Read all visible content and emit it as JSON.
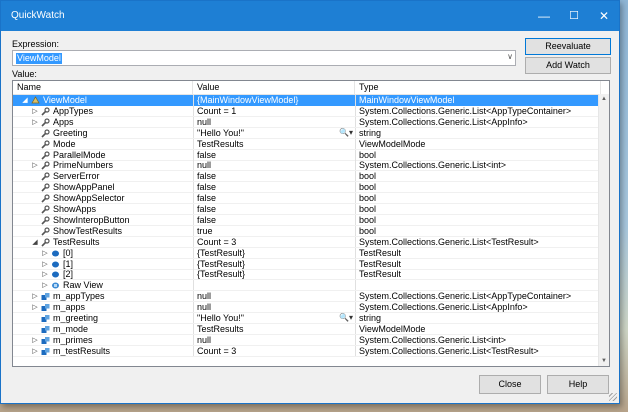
{
  "window": {
    "title": "QuickWatch",
    "minimize_icon": "—",
    "maximize_icon": "☐",
    "close_icon": "✕"
  },
  "expression": {
    "label": "Expression:",
    "value": "ViewModel",
    "dropdown_icon": "∨"
  },
  "value_label": "Value:",
  "buttons": {
    "reevaluate": "Reevaluate",
    "add_watch": "Add Watch",
    "close": "Close",
    "help": "Help"
  },
  "columns": {
    "name": "Name",
    "value": "Value",
    "type": "Type"
  },
  "rows": [
    {
      "indent": 0,
      "expander": "◢",
      "icon": "class",
      "name": "ViewModel",
      "value": "{MainWindowViewModel}",
      "type": "MainWindowViewModel",
      "selected": true
    },
    {
      "indent": 1,
      "expander": "▷",
      "icon": "wrench",
      "name": "AppTypes",
      "value": "Count = 1",
      "type": "System.Collections.Generic.List<AppTypeContainer>"
    },
    {
      "indent": 1,
      "expander": "▷",
      "icon": "wrench",
      "name": "Apps",
      "value": "null",
      "type": "System.Collections.Generic.List<AppInfo>"
    },
    {
      "indent": 1,
      "expander": "",
      "icon": "wrench",
      "name": "Greeting",
      "value": "\"Hello You!\"",
      "type": "string",
      "magnifier": true
    },
    {
      "indent": 1,
      "expander": "",
      "icon": "wrench",
      "name": "Mode",
      "value": "TestResults",
      "type": "ViewModelMode"
    },
    {
      "indent": 1,
      "expander": "",
      "icon": "wrench",
      "name": "ParallelMode",
      "value": "false",
      "type": "bool"
    },
    {
      "indent": 1,
      "expander": "▷",
      "icon": "wrench",
      "name": "PrimeNumbers",
      "value": "null",
      "type": "System.Collections.Generic.List<int>"
    },
    {
      "indent": 1,
      "expander": "",
      "icon": "wrench",
      "name": "ServerError",
      "value": "false",
      "type": "bool"
    },
    {
      "indent": 1,
      "expander": "",
      "icon": "wrench",
      "name": "ShowAppPanel",
      "value": "false",
      "type": "bool"
    },
    {
      "indent": 1,
      "expander": "",
      "icon": "wrench",
      "name": "ShowAppSelector",
      "value": "false",
      "type": "bool"
    },
    {
      "indent": 1,
      "expander": "",
      "icon": "wrench",
      "name": "ShowApps",
      "value": "false",
      "type": "bool"
    },
    {
      "indent": 1,
      "expander": "",
      "icon": "wrench",
      "name": "ShowInteropButton",
      "value": "false",
      "type": "bool"
    },
    {
      "indent": 1,
      "expander": "",
      "icon": "wrench",
      "name": "ShowTestResults",
      "value": "true",
      "type": "bool"
    },
    {
      "indent": 1,
      "expander": "◢",
      "icon": "wrench",
      "name": "TestResults",
      "value": "Count = 3",
      "type": "System.Collections.Generic.List<TestResult>"
    },
    {
      "indent": 2,
      "expander": "▷",
      "icon": "item",
      "name": "[0]",
      "value": "{TestResult}",
      "type": "TestResult"
    },
    {
      "indent": 2,
      "expander": "▷",
      "icon": "item",
      "name": "[1]",
      "value": "{TestResult}",
      "type": "TestResult"
    },
    {
      "indent": 2,
      "expander": "▷",
      "icon": "item",
      "name": "[2]",
      "value": "{TestResult}",
      "type": "TestResult"
    },
    {
      "indent": 2,
      "expander": "▷",
      "icon": "raw",
      "name": "Raw View",
      "value": "",
      "type": ""
    },
    {
      "indent": 1,
      "expander": "▷",
      "icon": "field",
      "name": "m_appTypes",
      "value": "null",
      "type": "System.Collections.Generic.List<AppTypeContainer>"
    },
    {
      "indent": 1,
      "expander": "▷",
      "icon": "field",
      "name": "m_apps",
      "value": "null",
      "type": "System.Collections.Generic.List<AppInfo>"
    },
    {
      "indent": 1,
      "expander": "",
      "icon": "field",
      "name": "m_greeting",
      "value": "\"Hello You!\"",
      "type": "string",
      "magnifier": true
    },
    {
      "indent": 1,
      "expander": "",
      "icon": "field",
      "name": "m_mode",
      "value": "TestResults",
      "type": "ViewModelMode"
    },
    {
      "indent": 1,
      "expander": "▷",
      "icon": "field",
      "name": "m_primes",
      "value": "null",
      "type": "System.Collections.Generic.List<int>"
    },
    {
      "indent": 1,
      "expander": "▷",
      "icon": "field",
      "name": "m_testResults",
      "value": "Count = 3",
      "type": "System.Collections.Generic.List<TestResult>"
    }
  ],
  "magnifier_icon": "🔍▾",
  "colors": {
    "titlebar": "#1e7fd4",
    "selection": "#3399ff",
    "field_icon": "#1c6bbf",
    "wrench": "#555555"
  }
}
